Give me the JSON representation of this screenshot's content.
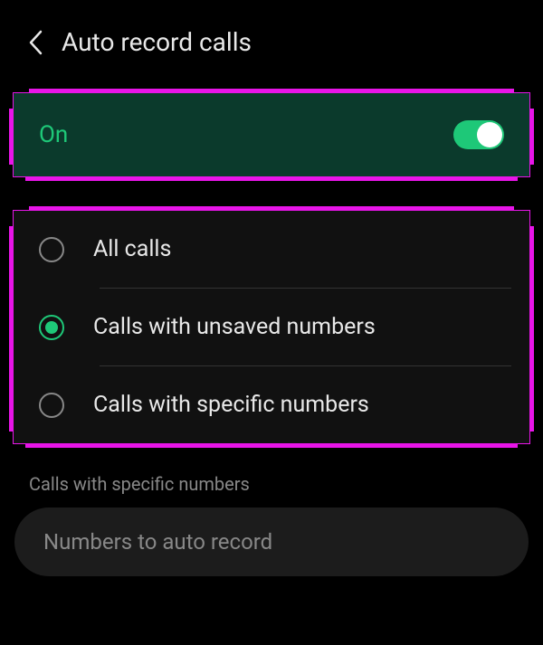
{
  "header": {
    "title": "Auto record calls"
  },
  "toggle": {
    "label": "On",
    "state": true
  },
  "options": [
    {
      "label": "All calls",
      "selected": false
    },
    {
      "label": "Calls with unsaved numbers",
      "selected": true
    },
    {
      "label": "Calls with specific numbers",
      "selected": false
    }
  ],
  "section": {
    "label": "Calls with specific numbers",
    "input_placeholder": "Numbers to auto record"
  }
}
